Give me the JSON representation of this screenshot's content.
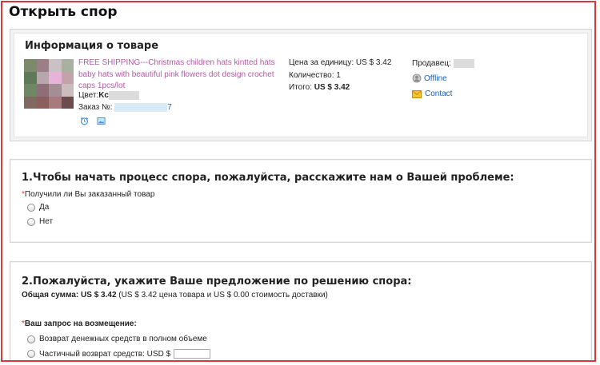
{
  "page": {
    "title": "Открыть спор"
  },
  "product": {
    "section_title": "Информация о товаре",
    "name": "FREE SHIPPING---Christmas children hats kintted hats baby hats with beautiful pink flowers dot design crochet caps 1pcs/lot",
    "color_label": "Цвет:",
    "color_value": "Kc",
    "order_label": "Заказ №:",
    "order_tail": "7",
    "unit_price_label": "Цена за единицу:",
    "unit_price_value": "US $ 3.42",
    "quantity_label": "Количество:",
    "quantity_value": "1",
    "total_label": "Итого:",
    "total_value": "US $ 3.42",
    "seller_label": "Продавец:",
    "seller_status": "Offline",
    "contact_label": "Contact",
    "icons": [
      "alarm-clock-icon",
      "image-icon",
      "offline-status-icon",
      "mail-icon"
    ]
  },
  "question1": {
    "title": "1.Чтобы начать процесс спора, пожалуйста, расскажите нам о Вашей проблеме:",
    "required_mark": "*",
    "field_label": "Получили ли Вы заказанный товар",
    "options": [
      "Да",
      "Нет"
    ]
  },
  "question2": {
    "title": "2.Пожалуйста, укажите Ваше предложение по решению спора:",
    "total_label": "Общая сумма:",
    "total_value": "US $ 3.42",
    "total_detail": "(US $ 3.42 цена товара и US $ 0.00 стоимость доставки)",
    "required_mark": "*",
    "refund_label": "Ваш запрос на возмещение:",
    "options": [
      "Возврат денежных средств в полном объеме",
      "Частичный возврат средств: USD $"
    ],
    "partial_amount_value": ""
  },
  "colors": {
    "border_red": "#d9363e",
    "link_purple": "#b25aa0",
    "link_blue": "#1a5fb4"
  }
}
